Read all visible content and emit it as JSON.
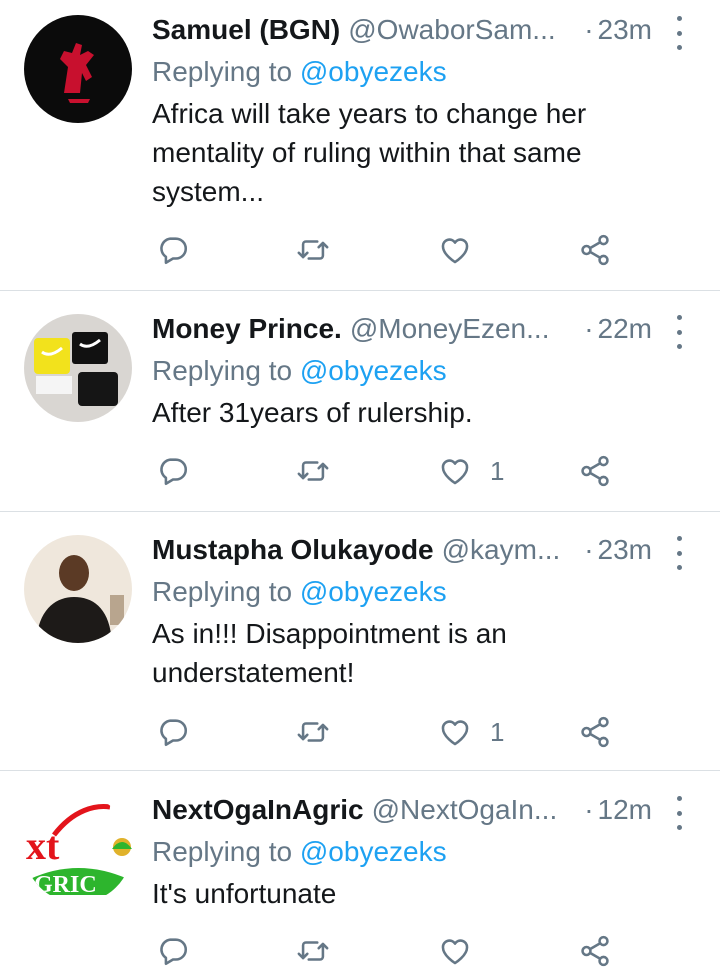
{
  "tweets": [
    {
      "name": "Samuel (BGN)",
      "handle": "@OwaborSam...",
      "sep": "·",
      "time": "23m",
      "replying_prefix": "Replying to ",
      "replying_to": "@obyezeks",
      "text": "Africa will take years to change her mentality of ruling within that same system...",
      "like_count": "",
      "avatar_colors": {
        "bg": "#0b0b0b",
        "fg": "#c8102e"
      }
    },
    {
      "name": "Money Prince.",
      "handle": "@MoneyEzen...",
      "sep": "·",
      "time": "22m",
      "replying_prefix": "Replying to ",
      "replying_to": "@obyezeks",
      "text": "After 31years of rulership.",
      "like_count": "1",
      "avatar_colors": {
        "bg": "#d9d6d2",
        "accent": "#f2e21c"
      }
    },
    {
      "name": "Mustapha Olukayode",
      "handle": "@kaym...",
      "sep": "·",
      "time": "23m",
      "replying_prefix": "Replying to ",
      "replying_to": "@obyezeks",
      "text": "As in!!! Disappointment is an understatement!",
      "like_count": "1",
      "avatar_colors": {
        "bg": "#efe7dc",
        "skin": "#5b3a25"
      }
    },
    {
      "name": "NextOgaInAgric",
      "handle": "@NextOgaIn...",
      "sep": "·",
      "time": "12m",
      "replying_prefix": "Replying to ",
      "replying_to": "@obyezeks",
      "text": "It's unfortunate",
      "like_count": "",
      "avatar_colors": {
        "bg": "#ffffff",
        "red": "#e3141b",
        "green": "#2db52d"
      }
    }
  ],
  "logo_text": {
    "top": "xt",
    "bottom": "GRIC"
  },
  "colors": {
    "accent": "#1da1f2",
    "secondary_text": "#657786",
    "divider": "#dbe0e4"
  },
  "icons": {
    "reply": "reply-icon",
    "retweet": "retweet-icon",
    "like": "heart-icon",
    "share": "share-icon",
    "more": "more-vertical-icon"
  }
}
